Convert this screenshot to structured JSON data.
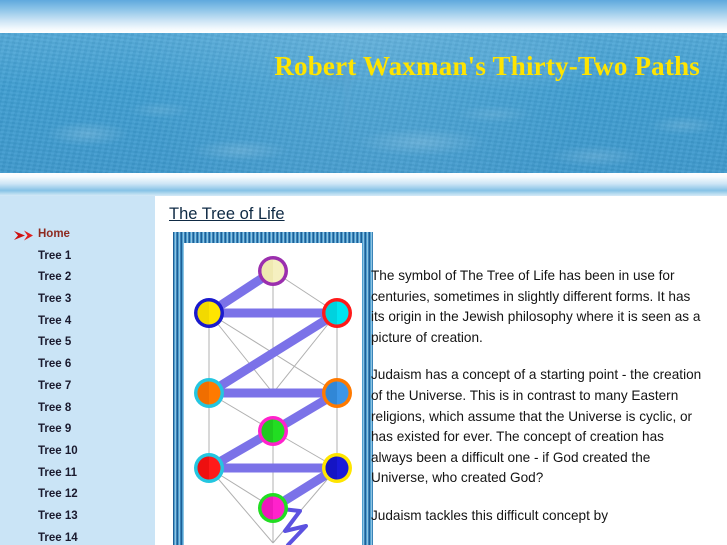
{
  "header": {
    "title": "Robert Waxman's Thirty-Two Paths",
    "title_color": "#FFE400",
    "band_color": "#3f9ed2"
  },
  "sidebar": {
    "background_color": "#cae4f6",
    "current_item_color": "#8e2a20",
    "marker_icon": "red-arrow-icon",
    "items": [
      {
        "label": "Home",
        "current": true
      },
      {
        "label": "Tree 1",
        "current": false
      },
      {
        "label": "Tree 2",
        "current": false
      },
      {
        "label": "Tree 3",
        "current": false
      },
      {
        "label": "Tree 4",
        "current": false
      },
      {
        "label": "Tree 5",
        "current": false
      },
      {
        "label": "Tree 6",
        "current": false
      },
      {
        "label": "Tree 7",
        "current": false
      },
      {
        "label": "Tree 8",
        "current": false
      },
      {
        "label": "Tree 9",
        "current": false
      },
      {
        "label": "Tree 10",
        "current": false
      },
      {
        "label": "Tree 11",
        "current": false
      },
      {
        "label": "Tree 12",
        "current": false
      },
      {
        "label": "Tree 13",
        "current": false
      },
      {
        "label": "Tree 14",
        "current": false
      }
    ]
  },
  "main": {
    "figure": {
      "caption": "The Tree of Life",
      "alt_name": "tree-of-life-diagram",
      "frame_style": "striped-blue-border",
      "sephiroth": [
        {
          "id": "keter",
          "row": 1,
          "col": "center",
          "fill": "#f5f0c0",
          "ring": "#9b2fae"
        },
        {
          "id": "chokhmah",
          "row": 2,
          "col": "right",
          "fill": "#00e5f0",
          "ring": "#ff1a1a"
        },
        {
          "id": "binah",
          "row": 2,
          "col": "left",
          "fill": "#ffe500",
          "ring": "#1a1acc"
        },
        {
          "id": "chesed",
          "row": 3,
          "col": "right",
          "fill": "#3d96e8",
          "ring": "#ff7a00"
        },
        {
          "id": "gevurah",
          "row": 3,
          "col": "left",
          "fill": "#ff7a00",
          "ring": "#24c6e0"
        },
        {
          "id": "tiferet",
          "row": 4,
          "col": "center",
          "fill": "#22dd22",
          "ring": "#ff22cc"
        },
        {
          "id": "netzach",
          "row": 5,
          "col": "right",
          "fill": "#1a1ad9",
          "ring": "#ffe500"
        },
        {
          "id": "hod",
          "row": 5,
          "col": "left",
          "fill": "#ff1a1a",
          "ring": "#24c6e0"
        },
        {
          "id": "yesod",
          "row": 6,
          "col": "center",
          "fill": "#ff22cc",
          "ring": "#22dd22"
        }
      ],
      "lightning_color": "#7b72e8",
      "path_color": "#aaaaaa"
    },
    "paragraphs": [
      "The symbol of The Tree of Life has been in use for centuries, sometimes in slightly different forms. It has its origin in the Jewish philosophy where it is seen as a picture of creation.",
      "Judaism has a concept of a starting point - the creation of the Universe. This is in contrast to many Eastern religions, which assume that the Universe is cyclic, or has existed for ever. The concept of creation has always been a difficult one - if God created the Universe, who created God?",
      "Judaism tackles this difficult concept by"
    ]
  }
}
